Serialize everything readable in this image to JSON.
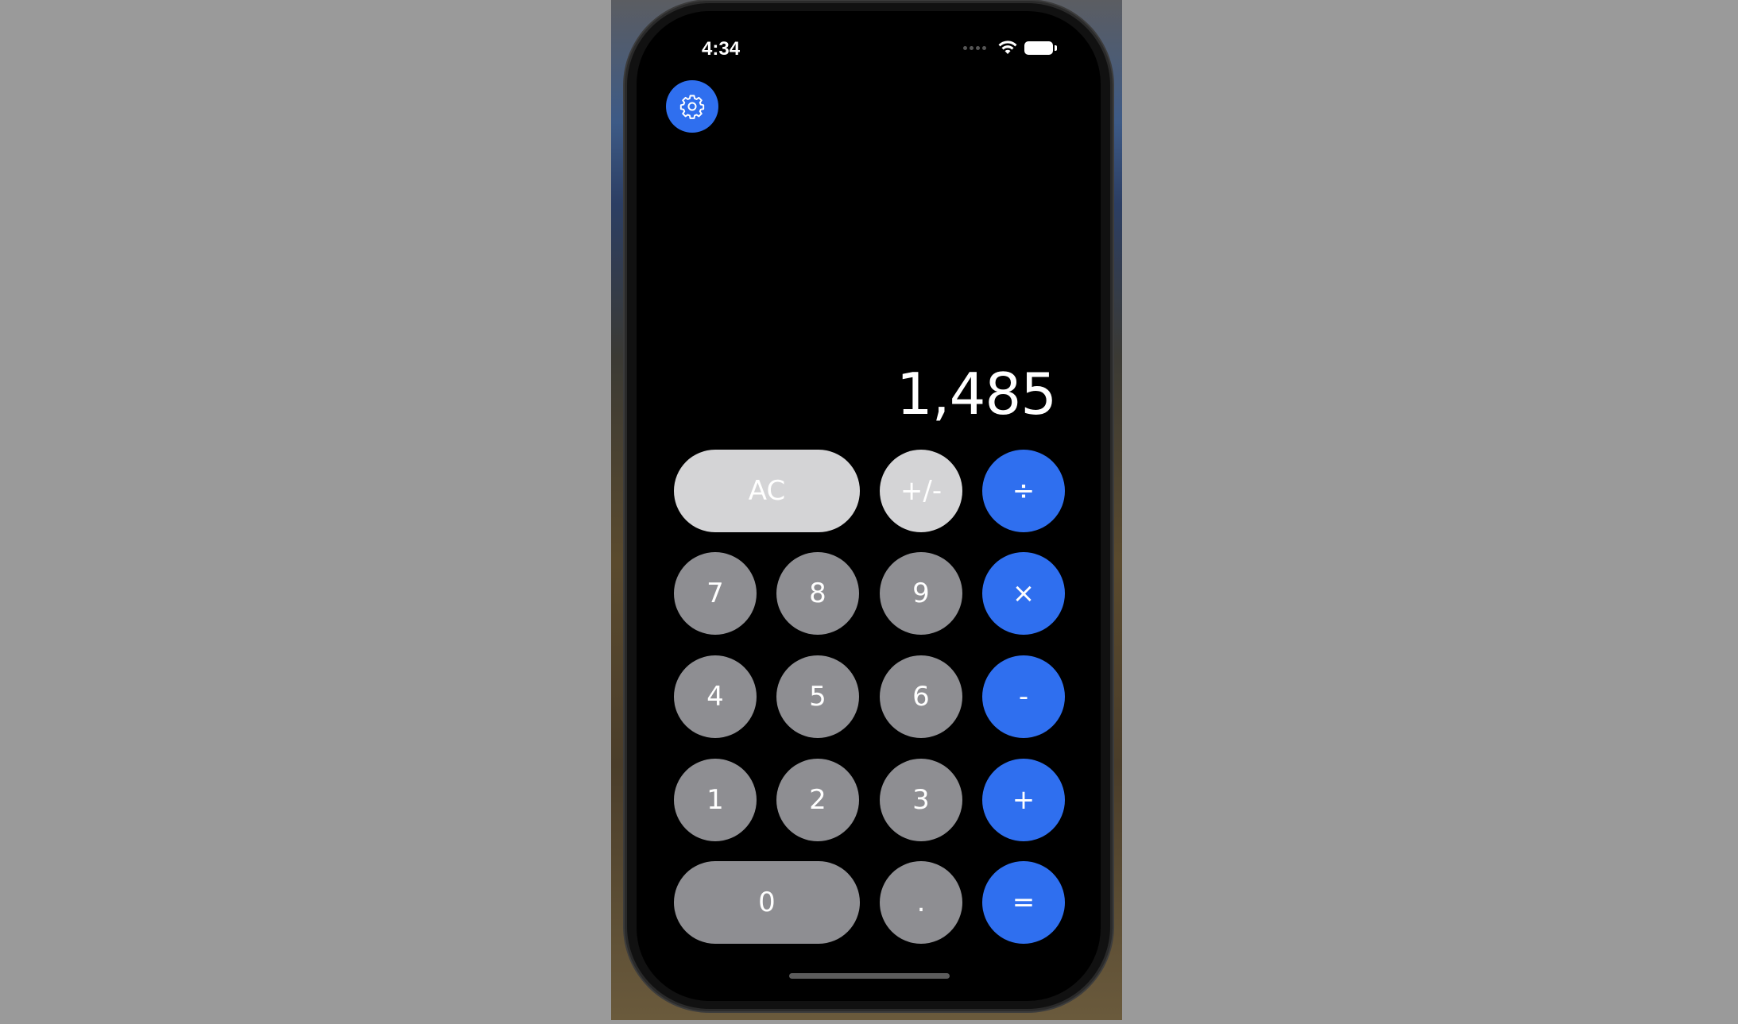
{
  "status_bar": {
    "time": "4:34"
  },
  "icons": {
    "settings": "gear-icon",
    "wifi": "wifi-icon",
    "battery": "battery-icon",
    "cellular": "cellular-signal-icon"
  },
  "display": {
    "value": "1,485"
  },
  "keypad": {
    "row1": [
      "AC",
      "+/-",
      "÷"
    ],
    "row2": [
      "7",
      "8",
      "9",
      "×"
    ],
    "row3": [
      "4",
      "5",
      "6",
      "-"
    ],
    "row4": [
      "1",
      "2",
      "3",
      "+"
    ],
    "row5": [
      "0",
      ".",
      "="
    ]
  },
  "colors": {
    "accent": "#2f6fef",
    "function_key": "#d4d4d6",
    "digit_key": "#8e8e92",
    "background": "#000000"
  }
}
